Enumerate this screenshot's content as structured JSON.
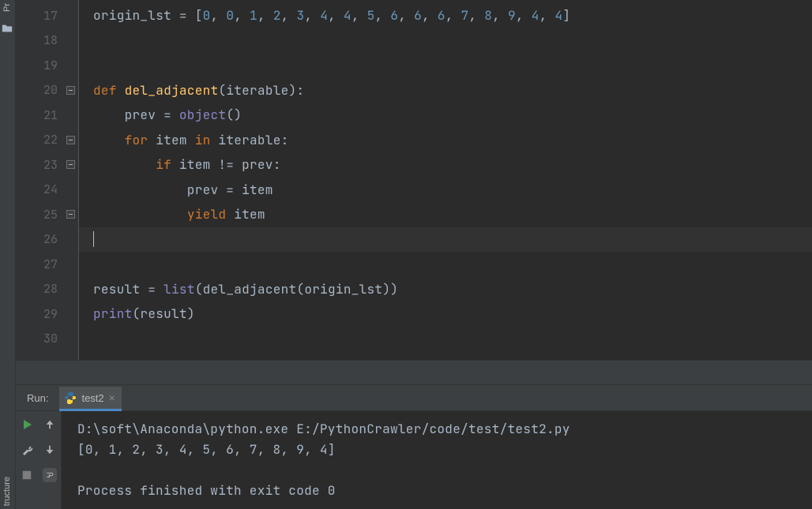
{
  "sidebar": {
    "top_label": "Pr",
    "bottom_label": "tructure"
  },
  "editor": {
    "lines": [
      {
        "num": 17
      },
      {
        "num": 18
      },
      {
        "num": 19
      },
      {
        "num": 20,
        "fold": true
      },
      {
        "num": 21
      },
      {
        "num": 22,
        "fold": true
      },
      {
        "num": 23,
        "fold": true
      },
      {
        "num": 24
      },
      {
        "num": 25,
        "fold": true
      },
      {
        "num": 26,
        "current": true
      },
      {
        "num": 27
      },
      {
        "num": 28
      },
      {
        "num": 29
      },
      {
        "num": 30
      }
    ],
    "code": {
      "l17_pre": "origin_lst = [",
      "l17_nums": [
        "0",
        "0",
        "1",
        "2",
        "3",
        "4",
        "4",
        "5",
        "6",
        "6",
        "6",
        "7",
        "8",
        "9",
        "4",
        "4"
      ],
      "l17_post": "]",
      "l20_def": "def ",
      "l20_fn": "del_adjacent",
      "l20_params": "(iterable):",
      "l21": "    prev = ",
      "l21_obj": "object",
      "l21_post": "()",
      "l22_for": "    for ",
      "l22_mid": "item ",
      "l22_in": "in ",
      "l22_post": "iterable:",
      "l23_if": "        if ",
      "l23_post": "item != prev:",
      "l24": "            prev = item",
      "l25_pre": "            ",
      "l25_yield": "yield ",
      "l25_post": "item",
      "l28_pre": "result = ",
      "l28_list": "list",
      "l28_post": "(del_adjacent(origin_lst))",
      "l29_print": "print",
      "l29_post": "(result)"
    }
  },
  "run": {
    "label": "Run:",
    "tab_name": "test2",
    "console_line1": "D:\\soft\\Anaconda\\python.exe E:/PythonCrawler/code/test/test2.py",
    "console_line2": "[0, 1, 2, 3, 4, 5, 6, 7, 8, 9, 4]",
    "console_line3": "Process finished with exit code 0"
  }
}
